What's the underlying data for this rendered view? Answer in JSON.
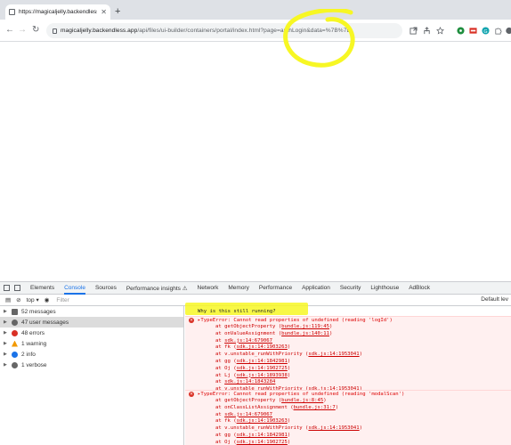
{
  "browser": {
    "tab_title": "https://magicaljelly.backendless...",
    "tab_close": "✕",
    "new_tab": "+",
    "back": "←",
    "forward": "→",
    "reload": "↻",
    "url_host": "magicaljelly.backendless.app",
    "url_path": "/api/files/ui-builder/containers/portal/index.html?page=authLogin&data=%7B%7D",
    "toolbar_icons": [
      "external-link-icon",
      "share-icon",
      "star-icon",
      "extension-green-icon",
      "extension-red-icon",
      "extension-teal-icon",
      "puzzle-icon",
      "profile-icon"
    ],
    "annotation_color": "#f7f724"
  },
  "devtools": {
    "tabs": [
      "Elements",
      "Console",
      "Sources",
      "Performance insights ⚠",
      "Network",
      "Memory",
      "Performance",
      "Application",
      "Security",
      "Lighthouse",
      "AdBlock"
    ],
    "active_tab": "Console",
    "context": "top ▾",
    "filter_placeholder": "Filter",
    "default_levels": "Default lev",
    "sidebar": [
      {
        "label": "52 messages",
        "icon": "list-icon",
        "color": "#666666"
      },
      {
        "label": "47 user messages",
        "icon": "user-icon",
        "color": "#666666"
      },
      {
        "label": "48 errors",
        "icon": "error-icon",
        "color": "#d93025"
      },
      {
        "label": "1 warning",
        "icon": "warning-icon",
        "color": "#f29900"
      },
      {
        "label": "2 info",
        "icon": "info-icon",
        "color": "#1a73e8"
      },
      {
        "label": "1 verbose",
        "icon": "verbose-icon",
        "color": "#666666"
      }
    ],
    "console_log": "Why is this still running?",
    "errors": [
      {
        "message": "▸TypeError: Cannot read properties of undefined (reading 'logId')",
        "frames": [
          {
            "text": "at getObjectProperty (",
            "link": "bundle.js:119:45",
            "end": ")"
          },
          {
            "text": "at onValueAssignment (",
            "link": "bundle.js:140:11",
            "end": ")"
          },
          {
            "text": "at ",
            "link": "sdk.js:14:679067",
            "end": ""
          },
          {
            "text": "at fk (",
            "link": "sdk.js:14:1903263",
            "end": ")"
          },
          {
            "text": "at v.unstable_runWithPriority (",
            "link": "sdk.js:14:1953041",
            "end": ")"
          },
          {
            "text": "at gg (",
            "link": "sdk.js:14:1842981",
            "end": ")"
          },
          {
            "text": "at Oj (",
            "link": "sdk.js:14:1902725",
            "end": ")"
          },
          {
            "text": "at Lj (",
            "link": "sdk.js:14:1893938",
            "end": ")"
          },
          {
            "text": "at ",
            "link": "sdk.js:14:1843284",
            "end": ""
          },
          {
            "text": "at v.unstable_runWithPriority (",
            "link": "sdk.js:14:1953041",
            "end": ")"
          }
        ]
      },
      {
        "message": "▸TypeError: Cannot read properties of undefined (reading 'modalScan')",
        "frames": [
          {
            "text": "at getObjectProperty (",
            "link": "bundle.js:8:45",
            "end": ")"
          },
          {
            "text": "at onClassListAssignment (",
            "link": "bundle.js:31:7",
            "end": ")"
          },
          {
            "text": "at ",
            "link": "sdk.js:14:679067",
            "end": ""
          },
          {
            "text": "at fk (",
            "link": "sdk.js:14:1903263",
            "end": ")"
          },
          {
            "text": "at v.unstable_runWithPriority (",
            "link": "sdk.js:14:1953041",
            "end": ")"
          },
          {
            "text": "at gg (",
            "link": "sdk.js:14:1842981",
            "end": ")"
          },
          {
            "text": "at Oj (",
            "link": "sdk.js:14:1902725",
            "end": ")"
          }
        ]
      }
    ]
  }
}
